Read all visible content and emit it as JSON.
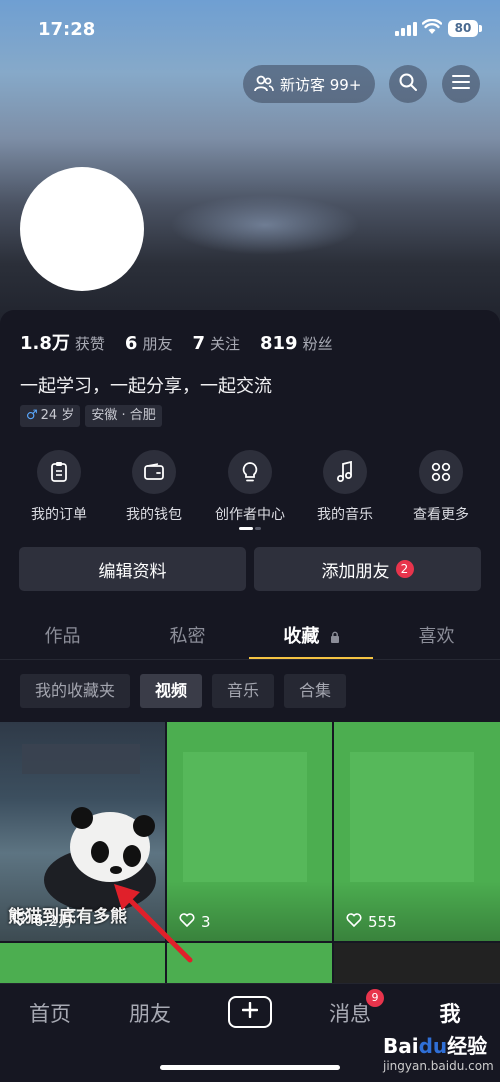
{
  "status": {
    "time": "17:28",
    "battery": "80"
  },
  "header": {
    "visitor_label": "新访客 99+"
  },
  "stats": [
    {
      "num": "1.8万",
      "label": "获赞"
    },
    {
      "num": "6",
      "label": "朋友"
    },
    {
      "num": "7",
      "label": "关注"
    },
    {
      "num": "819",
      "label": "粉丝"
    }
  ],
  "bio": "一起学习，一起分享，一起交流",
  "tags": {
    "age": "24 岁",
    "location": "安徽 · 合肥",
    "gender_symbol": "♂"
  },
  "shortcuts": [
    {
      "label": "我的订单",
      "icon": "clipboard-icon"
    },
    {
      "label": "我的钱包",
      "icon": "wallet-icon"
    },
    {
      "label": "创作者中心",
      "icon": "lightbulb-icon"
    },
    {
      "label": "我的音乐",
      "icon": "music-note-icon"
    },
    {
      "label": "查看更多",
      "icon": "grid-icon"
    }
  ],
  "actions": {
    "edit_profile": "编辑资料",
    "add_friend": "添加朋友",
    "add_friend_badge": "2"
  },
  "tabs": [
    "作品",
    "私密",
    "收藏",
    "喜欢"
  ],
  "chips": [
    "我的收藏夹",
    "视频",
    "音乐",
    "合集"
  ],
  "grid": {
    "items": [
      {
        "likes": "6.2万",
        "overlay": "熊猫到底有多熊"
      },
      {
        "likes": "3"
      },
      {
        "likes": "555"
      }
    ]
  },
  "bottom_nav": {
    "home": "首页",
    "friends": "朋友",
    "messages": "消息",
    "me": "我",
    "messages_badge": "9"
  },
  "watermark": {
    "brand_a": "Bai",
    "brand_b": "du",
    "brand_c": "经验",
    "site": "jingyan.baidu.com"
  },
  "colors": {
    "accent": "#f5c443",
    "badge": "#e8344c",
    "background": "#161722"
  }
}
